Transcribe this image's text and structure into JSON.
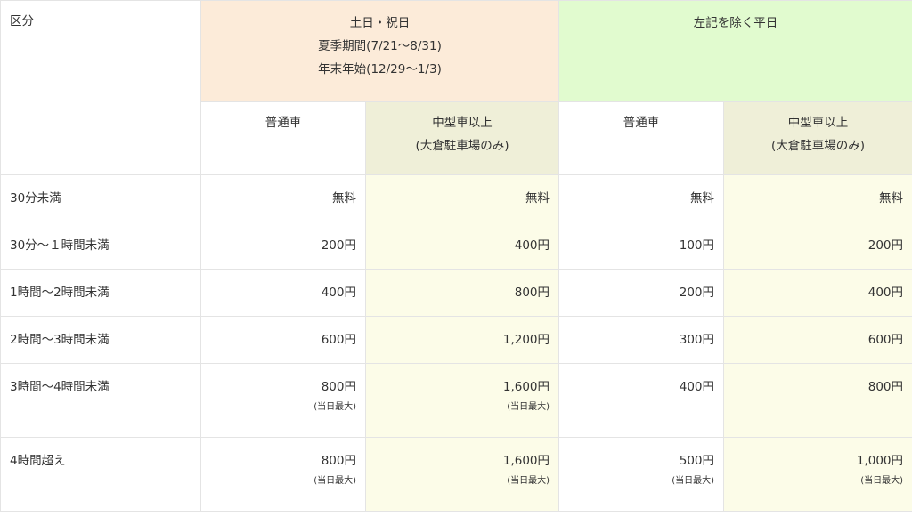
{
  "header": {
    "category_label": "区分",
    "holiday_group": [
      "土日・祝日",
      "夏季期間(7/21～8/31)",
      "年末年始(12/29～1/3)"
    ],
    "weekday_group": "左記を除く平日",
    "sub_regular": "普通車",
    "sub_large_line1": "中型車以上",
    "sub_large_line2": "(大倉駐車場のみ)"
  },
  "rows": [
    {
      "label": "30分未満",
      "values": [
        "無料",
        "無料",
        "無料",
        "無料"
      ],
      "notes": [
        "",
        "",
        "",
        ""
      ]
    },
    {
      "label": "30分～１時間未満",
      "values": [
        "200円",
        "400円",
        "100円",
        "200円"
      ],
      "notes": [
        "",
        "",
        "",
        ""
      ]
    },
    {
      "label": "1時間～2時間未満",
      "values": [
        "400円",
        "800円",
        "200円",
        "400円"
      ],
      "notes": [
        "",
        "",
        "",
        ""
      ]
    },
    {
      "label": "2時間～3時間未満",
      "values": [
        "600円",
        "1,200円",
        "300円",
        "600円"
      ],
      "notes": [
        "",
        "",
        "",
        ""
      ]
    },
    {
      "label": "3時間～4時間未満",
      "values": [
        "800円",
        "1,600円",
        "400円",
        "800円"
      ],
      "notes": [
        "(当日最大)",
        "(当日最大)",
        "",
        ""
      ]
    },
    {
      "label": "4時間超え",
      "values": [
        "800円",
        "1,600円",
        "500円",
        "1,000円"
      ],
      "notes": [
        "(当日最大)",
        "(当日最大)",
        "(当日最大)",
        "(当日最大)"
      ]
    }
  ],
  "colors": {
    "holiday_bg": "#fcebd9",
    "weekday_bg": "#e1fbcf",
    "large_header_bg": "#efefd8",
    "large_cell_bg": "#fcfce8",
    "border": "#e4e4e4"
  }
}
